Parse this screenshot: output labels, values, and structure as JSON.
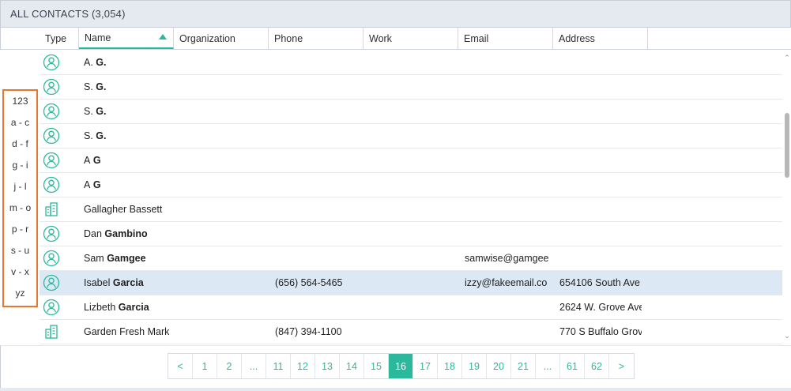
{
  "header": {
    "title": "ALL CONTACTS (3,054)"
  },
  "columns": {
    "type": "Type",
    "name": "Name",
    "organization": "Organization",
    "phone": "Phone",
    "work": "Work",
    "email": "Email",
    "address": "Address"
  },
  "alpha_index": [
    "123",
    "a - c",
    "d - f",
    "g - i",
    "j - l",
    "m - o",
    "p - r",
    "s - u",
    "v - x",
    "yz"
  ],
  "rows": [
    {
      "type": "person",
      "first": "A.",
      "last": "G.",
      "phone": "",
      "email": "",
      "address": "",
      "selected": false
    },
    {
      "type": "person",
      "first": "S.",
      "last": "G.",
      "phone": "",
      "email": "",
      "address": "",
      "selected": false
    },
    {
      "type": "person",
      "first": "S.",
      "last": "G.",
      "phone": "",
      "email": "",
      "address": "",
      "selected": false
    },
    {
      "type": "person",
      "first": "S.",
      "last": "G.",
      "phone": "",
      "email": "",
      "address": "",
      "selected": false
    },
    {
      "type": "person",
      "first": "A",
      "last": "G",
      "phone": "",
      "email": "",
      "address": "",
      "selected": false
    },
    {
      "type": "person",
      "first": "A",
      "last": "G",
      "phone": "",
      "email": "",
      "address": "",
      "selected": false
    },
    {
      "type": "organization",
      "first": "Gallagher Bassett",
      "last": "",
      "phone": "",
      "email": "",
      "address": "",
      "selected": false
    },
    {
      "type": "person",
      "first": "Dan",
      "last": "Gambino",
      "phone": "",
      "email": "",
      "address": "",
      "selected": false
    },
    {
      "type": "person",
      "first": "Sam",
      "last": "Gamgee",
      "phone": "",
      "email": "samwise@gamgee",
      "address": "",
      "selected": false
    },
    {
      "type": "person",
      "first": "Isabel",
      "last": "Garcia",
      "phone": "(656) 564-5465",
      "email": "izzy@fakeemail.co",
      "address": "654106 South Ave",
      "selected": true
    },
    {
      "type": "person",
      "first": "Lizbeth",
      "last": "Garcia",
      "phone": "",
      "email": "",
      "address": "2624 W. Grove Ave",
      "selected": false
    },
    {
      "type": "organization",
      "first": "Garden Fresh Mark",
      "last": "",
      "phone": "(847) 394-1100",
      "email": "",
      "address": "770 S Buffalo Grov",
      "selected": false
    }
  ],
  "pagination": {
    "prev": "<",
    "next": ">",
    "pages": [
      "1",
      "2",
      "...",
      "11",
      "12",
      "13",
      "14",
      "15",
      "16",
      "17",
      "18",
      "19",
      "20",
      "21",
      "...",
      "61",
      "62"
    ],
    "current": "16"
  },
  "icons": {
    "person": "person-icon",
    "organization": "building-icon",
    "sort": "sort-ascending-icon"
  },
  "colors": {
    "accent": "#2bb89c",
    "highlight": "#e8772e",
    "selected_row": "#dce9f5",
    "header_bg": "#e5e9f0"
  }
}
